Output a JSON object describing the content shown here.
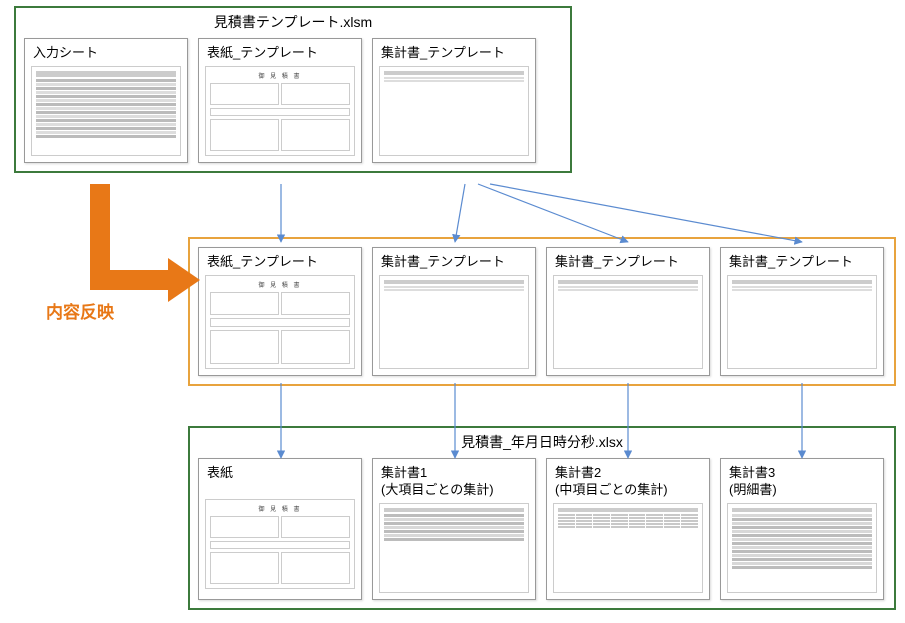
{
  "groups": {
    "top": {
      "title": "見積書テンプレート.xlsm"
    },
    "bottom": {
      "title": "見積書_年月日時分秒.xlsx"
    }
  },
  "top_cards": [
    {
      "title": "入力シート"
    },
    {
      "title": "表紙_テンプレート"
    },
    {
      "title": "集計書_テンプレート"
    }
  ],
  "mid_cards": [
    {
      "title": "表紙_テンプレート"
    },
    {
      "title": "集計書_テンプレート"
    },
    {
      "title": "集計書_テンプレート"
    },
    {
      "title": "集計書_テンプレート"
    }
  ],
  "bottom_cards": [
    {
      "title": "表紙",
      "sub": ""
    },
    {
      "title": "集計書1",
      "sub": "(大項目ごとの集計)"
    },
    {
      "title": "集計書2",
      "sub": "(中項目ごとの集計)"
    },
    {
      "title": "集計書3",
      "sub": "(明細書)"
    }
  ],
  "labels": {
    "hanei": "内容反映"
  }
}
